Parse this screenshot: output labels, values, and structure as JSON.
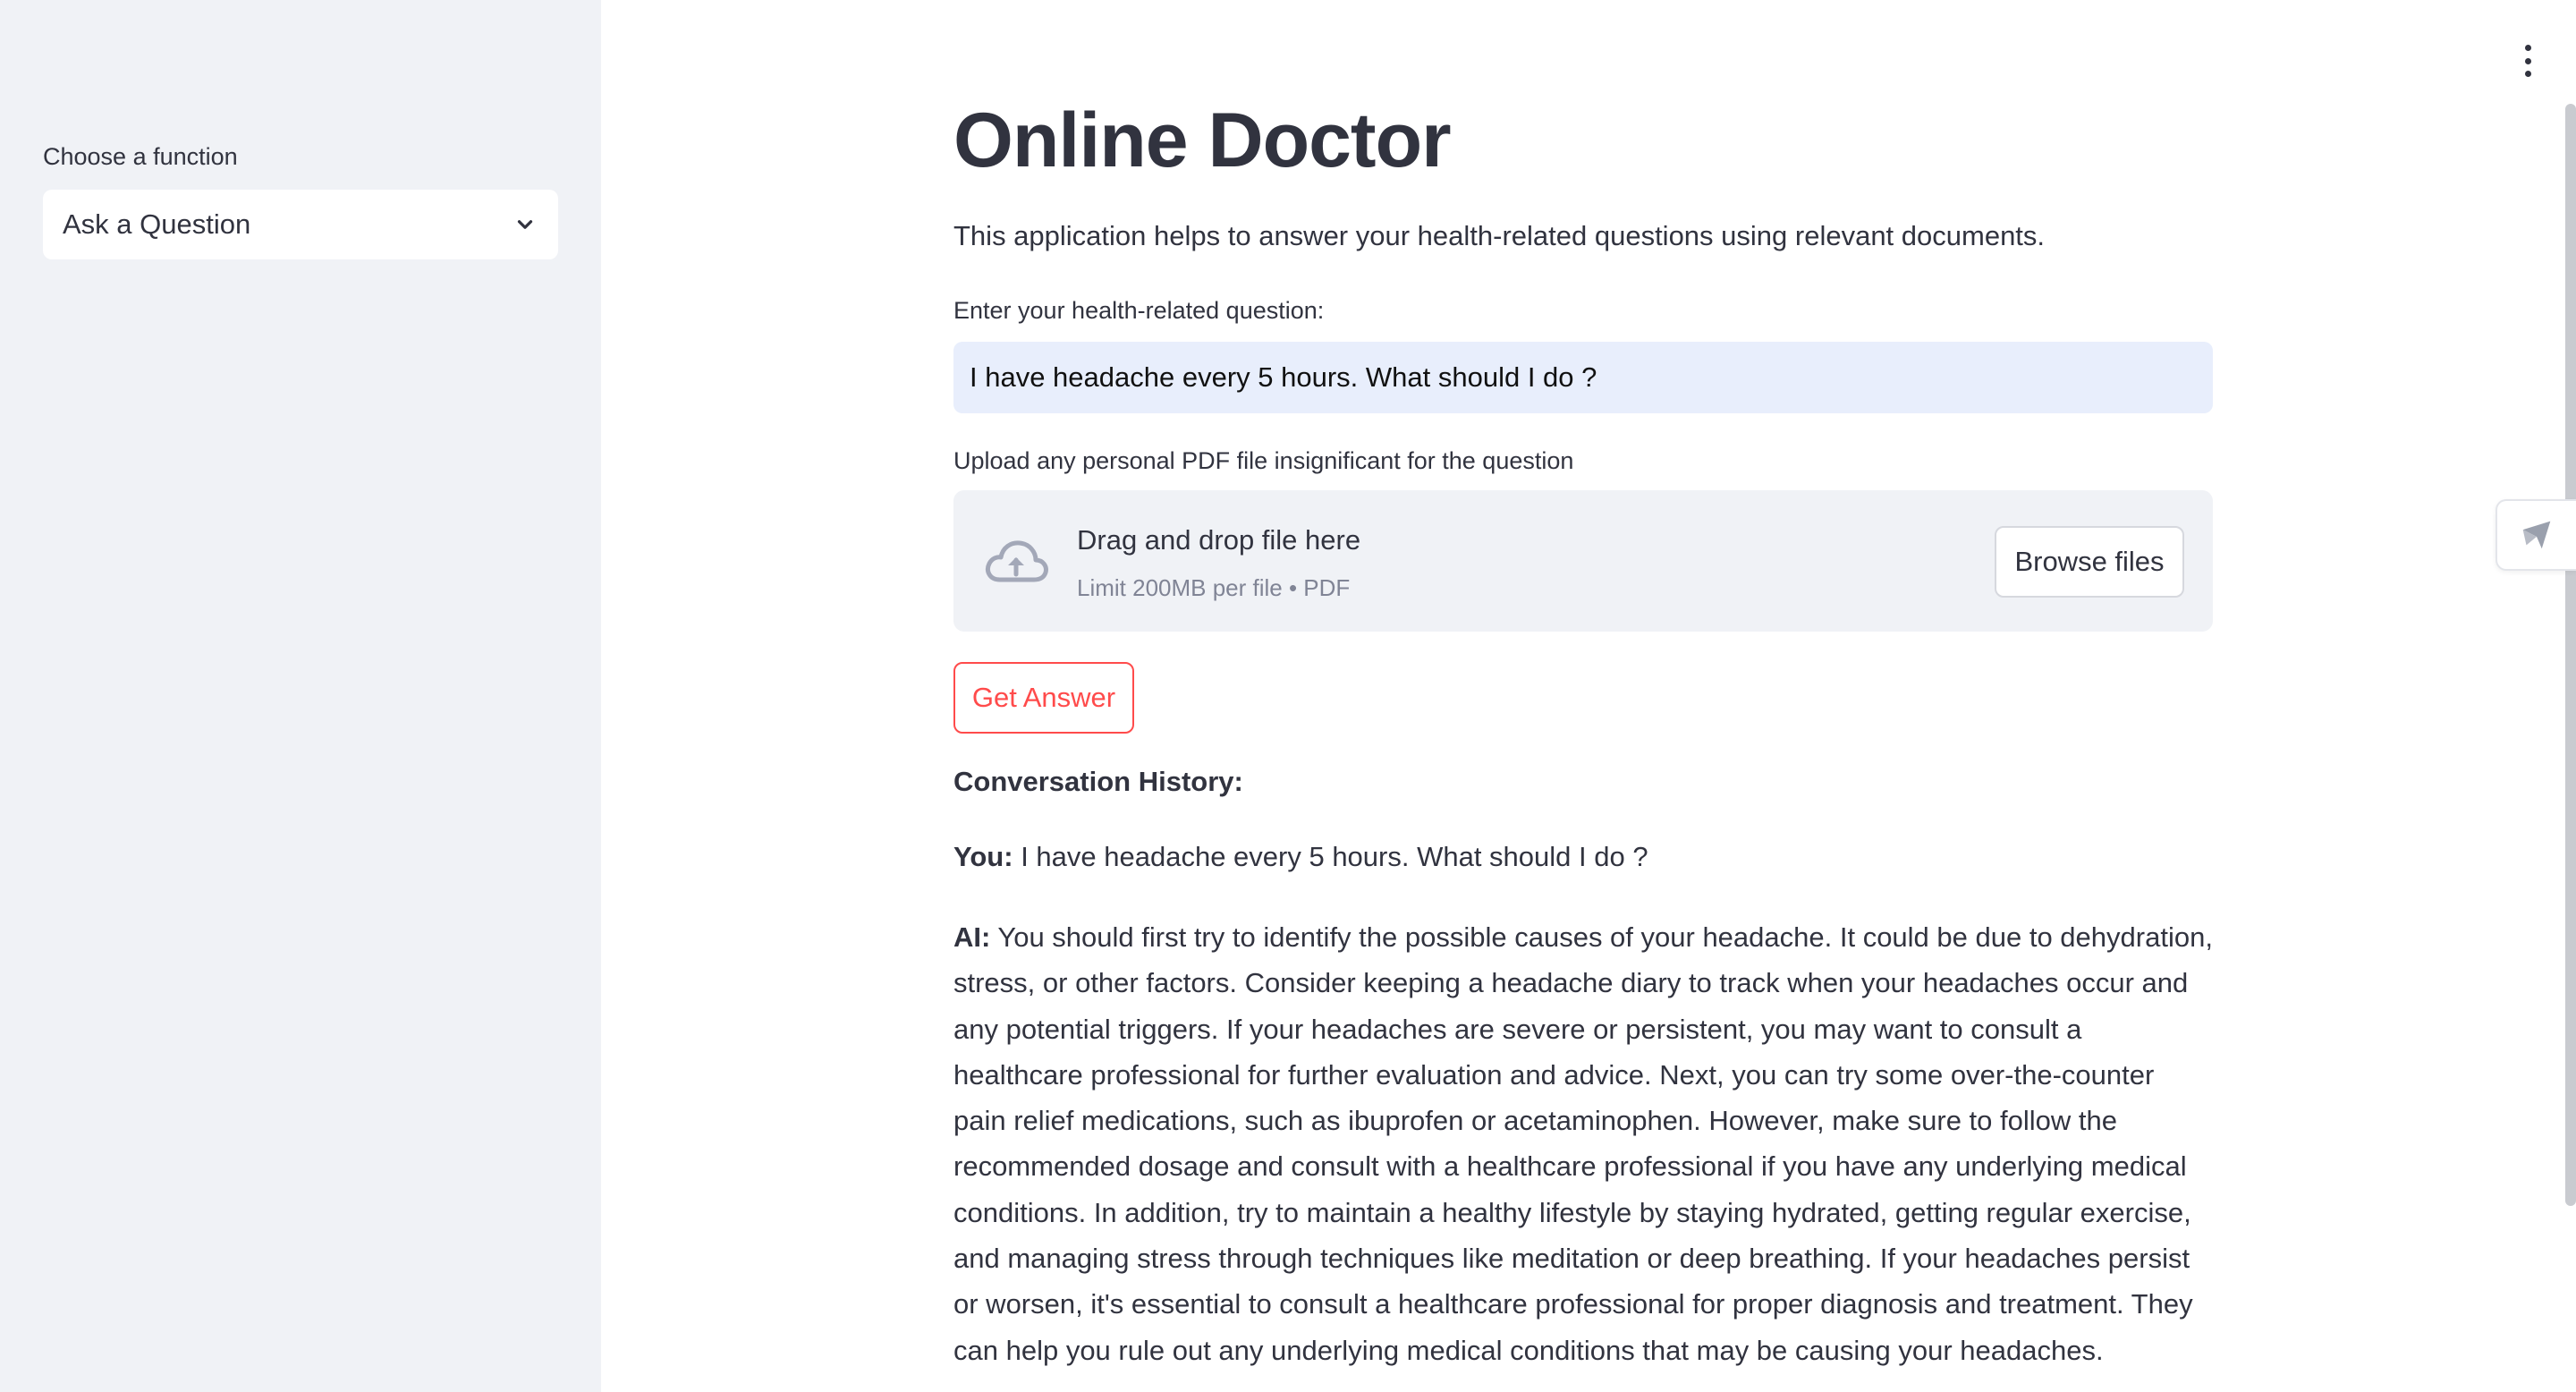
{
  "sidebar": {
    "select_label": "Choose a function",
    "select_value": "Ask a Question"
  },
  "main": {
    "title": "Online Doctor",
    "description": "This application helps to answer your health-related questions using relevant documents.",
    "question_label": "Enter your health-related question:",
    "question_value": "I have headache every 5 hours. What should I do ?",
    "upload_label": "Upload any personal PDF file insignificant for the question",
    "uploader": {
      "drag_text": "Drag and drop file here",
      "limit_text": "Limit 200MB per file • PDF",
      "browse_label": "Browse files"
    },
    "get_answer_label": "Get Answer",
    "history": {
      "title": "Conversation History:",
      "you_prefix": "You:",
      "you_text": " I have headache every 5 hours. What should I do ?",
      "ai_prefix": "AI:",
      "ai_text": " You should first try to identify the possible causes of your headache. It could be due to dehydration, stress, or other factors. Consider keeping a headache diary to track when your headaches occur and any potential triggers. If your headaches are severe or persistent, you may want to consult a healthcare professional for further evaluation and advice. Next, you can try some over-the-counter pain relief medications, such as ibuprofen or acetaminophen. However, make sure to follow the recommended dosage and consult with a healthcare professional if you have any underlying medical conditions. In addition, try to maintain a healthy lifestyle by staying hydrated, getting regular exercise, and managing stress through techniques like meditation or deep breathing. If your headaches persist or worsen, it's essential to consult a healthcare professional for proper diagnosis and treatment. They can help you rule out any underlying medical conditions that may be causing your headaches."
    }
  },
  "icons": {
    "select": "chevron-down-icon",
    "menu": "more-vertical-icon",
    "upload": "cloud-upload-icon",
    "deploy": "rocket-icon"
  },
  "colors": {
    "sidebar_bg": "#f0f2f6",
    "primary": "#ff4b4b",
    "input_bg": "#e8eefc",
    "text": "#31333f",
    "muted": "#808495"
  }
}
